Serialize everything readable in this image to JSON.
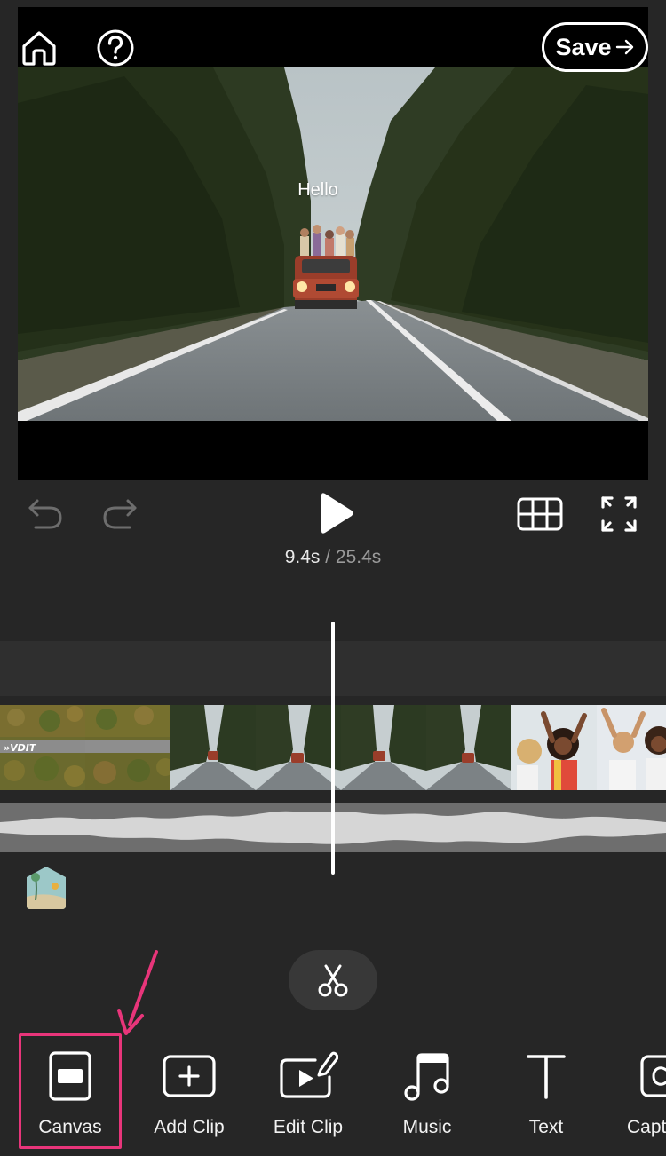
{
  "preview": {
    "overlay_text": "Hello",
    "save_label": "Save"
  },
  "playback": {
    "current_time": "9.4s",
    "separator": "/",
    "total_time": "25.4s"
  },
  "toolbar": {
    "tools": [
      {
        "label": "Canvas",
        "icon": "canvas-icon",
        "highlighted": true
      },
      {
        "label": "Add Clip",
        "icon": "add-clip-icon"
      },
      {
        "label": "Edit Clip",
        "icon": "edit-clip-icon"
      },
      {
        "label": "Music",
        "icon": "music-icon"
      },
      {
        "label": "Text",
        "icon": "text-icon"
      },
      {
        "label": "Capt",
        "icon": "captions-icon"
      }
    ]
  },
  "colors": {
    "background": "#262626",
    "highlight": "#e8357a",
    "audio_track": "#6e6e6e"
  }
}
